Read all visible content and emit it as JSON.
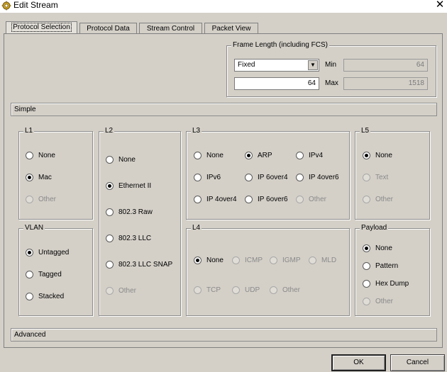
{
  "window": {
    "title": "Edit Stream",
    "close_glyph": "✕"
  },
  "tabs": [
    "Protocol Selection",
    "Protocol Data",
    "Stream Control",
    "Packet View"
  ],
  "frame_length": {
    "title": "Frame Length (including FCS)",
    "mode": "Fixed",
    "value": "64",
    "min_label": "Min",
    "min_value": "64",
    "max_label": "Max",
    "max_value": "1518"
  },
  "simple_label": "Simple",
  "advanced_label": "Advanced",
  "groups": {
    "l1": {
      "title": "L1",
      "options": [
        {
          "label": "None",
          "checked": false,
          "disabled": false
        },
        {
          "label": "Mac",
          "checked": true,
          "disabled": false
        },
        {
          "label": "Other",
          "checked": false,
          "disabled": true
        }
      ]
    },
    "vlan": {
      "title": "VLAN",
      "options": [
        {
          "label": "Untagged",
          "checked": true,
          "disabled": false
        },
        {
          "label": "Tagged",
          "checked": false,
          "disabled": false
        },
        {
          "label": "Stacked",
          "checked": false,
          "disabled": false
        }
      ]
    },
    "l2": {
      "title": "L2",
      "options": [
        {
          "label": "None",
          "checked": false,
          "disabled": false
        },
        {
          "label": "Ethernet II",
          "checked": true,
          "disabled": false
        },
        {
          "label": "802.3 Raw",
          "checked": false,
          "disabled": false
        },
        {
          "label": "802.3 LLC",
          "checked": false,
          "disabled": false
        },
        {
          "label": "802.3 LLC SNAP",
          "checked": false,
          "disabled": false
        },
        {
          "label": "Other",
          "checked": false,
          "disabled": true
        }
      ]
    },
    "l3": {
      "title": "L3",
      "options": [
        {
          "label": "None",
          "checked": false,
          "disabled": false
        },
        {
          "label": "ARP",
          "checked": true,
          "disabled": false
        },
        {
          "label": "IPv4",
          "checked": false,
          "disabled": false
        },
        {
          "label": "IPv6",
          "checked": false,
          "disabled": false
        },
        {
          "label": "IP 6over4",
          "checked": false,
          "disabled": false
        },
        {
          "label": "IP 4over6",
          "checked": false,
          "disabled": false
        },
        {
          "label": "IP 4over4",
          "checked": false,
          "disabled": false
        },
        {
          "label": "IP 6over6",
          "checked": false,
          "disabled": false
        },
        {
          "label": "Other",
          "checked": false,
          "disabled": true
        }
      ]
    },
    "l5": {
      "title": "L5",
      "options": [
        {
          "label": "None",
          "checked": true,
          "disabled": false
        },
        {
          "label": "Text",
          "checked": false,
          "disabled": true
        },
        {
          "label": "Other",
          "checked": false,
          "disabled": true
        }
      ]
    },
    "l4": {
      "title": "L4",
      "options": [
        {
          "label": "None",
          "checked": true,
          "disabled": false
        },
        {
          "label": "ICMP",
          "checked": false,
          "disabled": true
        },
        {
          "label": "IGMP",
          "checked": false,
          "disabled": true
        },
        {
          "label": "MLD",
          "checked": false,
          "disabled": true
        },
        {
          "label": "TCP",
          "checked": false,
          "disabled": true
        },
        {
          "label": "UDP",
          "checked": false,
          "disabled": true
        },
        {
          "label": "Other",
          "checked": false,
          "disabled": true
        }
      ]
    },
    "payload": {
      "title": "Payload",
      "options": [
        {
          "label": "None",
          "checked": true,
          "disabled": false
        },
        {
          "label": "Pattern",
          "checked": false,
          "disabled": false
        },
        {
          "label": "Hex Dump",
          "checked": false,
          "disabled": false
        },
        {
          "label": "Other",
          "checked": false,
          "disabled": true
        }
      ]
    }
  },
  "buttons": {
    "ok": "OK",
    "cancel": "Cancel"
  }
}
